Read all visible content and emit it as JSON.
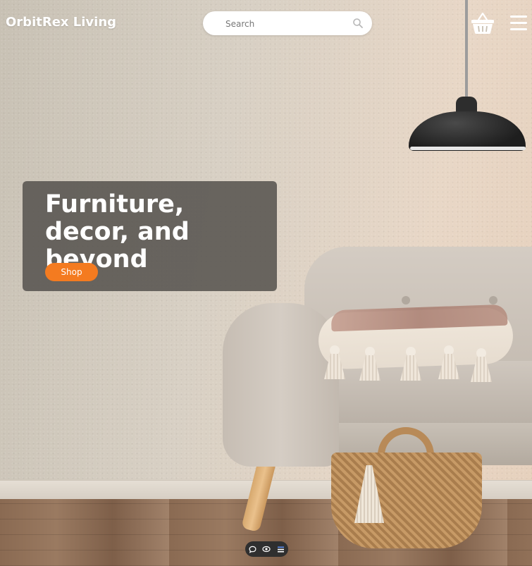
{
  "header": {
    "brand": "OrbitRex Living",
    "search": {
      "placeholder": "Search",
      "icon": "search-icon"
    },
    "cart_icon": "basket-icon",
    "menu_icon": "hamburger-menu-icon"
  },
  "hero": {
    "title": "Furniture, decor, and beyond",
    "cta_label": "Shop"
  },
  "toolbar": {
    "icons": [
      "chat-icon",
      "eye-icon",
      "list-icon"
    ]
  },
  "colors": {
    "accent": "#f47b20",
    "hero_overlay": "#585450",
    "text": "#ffffff"
  }
}
